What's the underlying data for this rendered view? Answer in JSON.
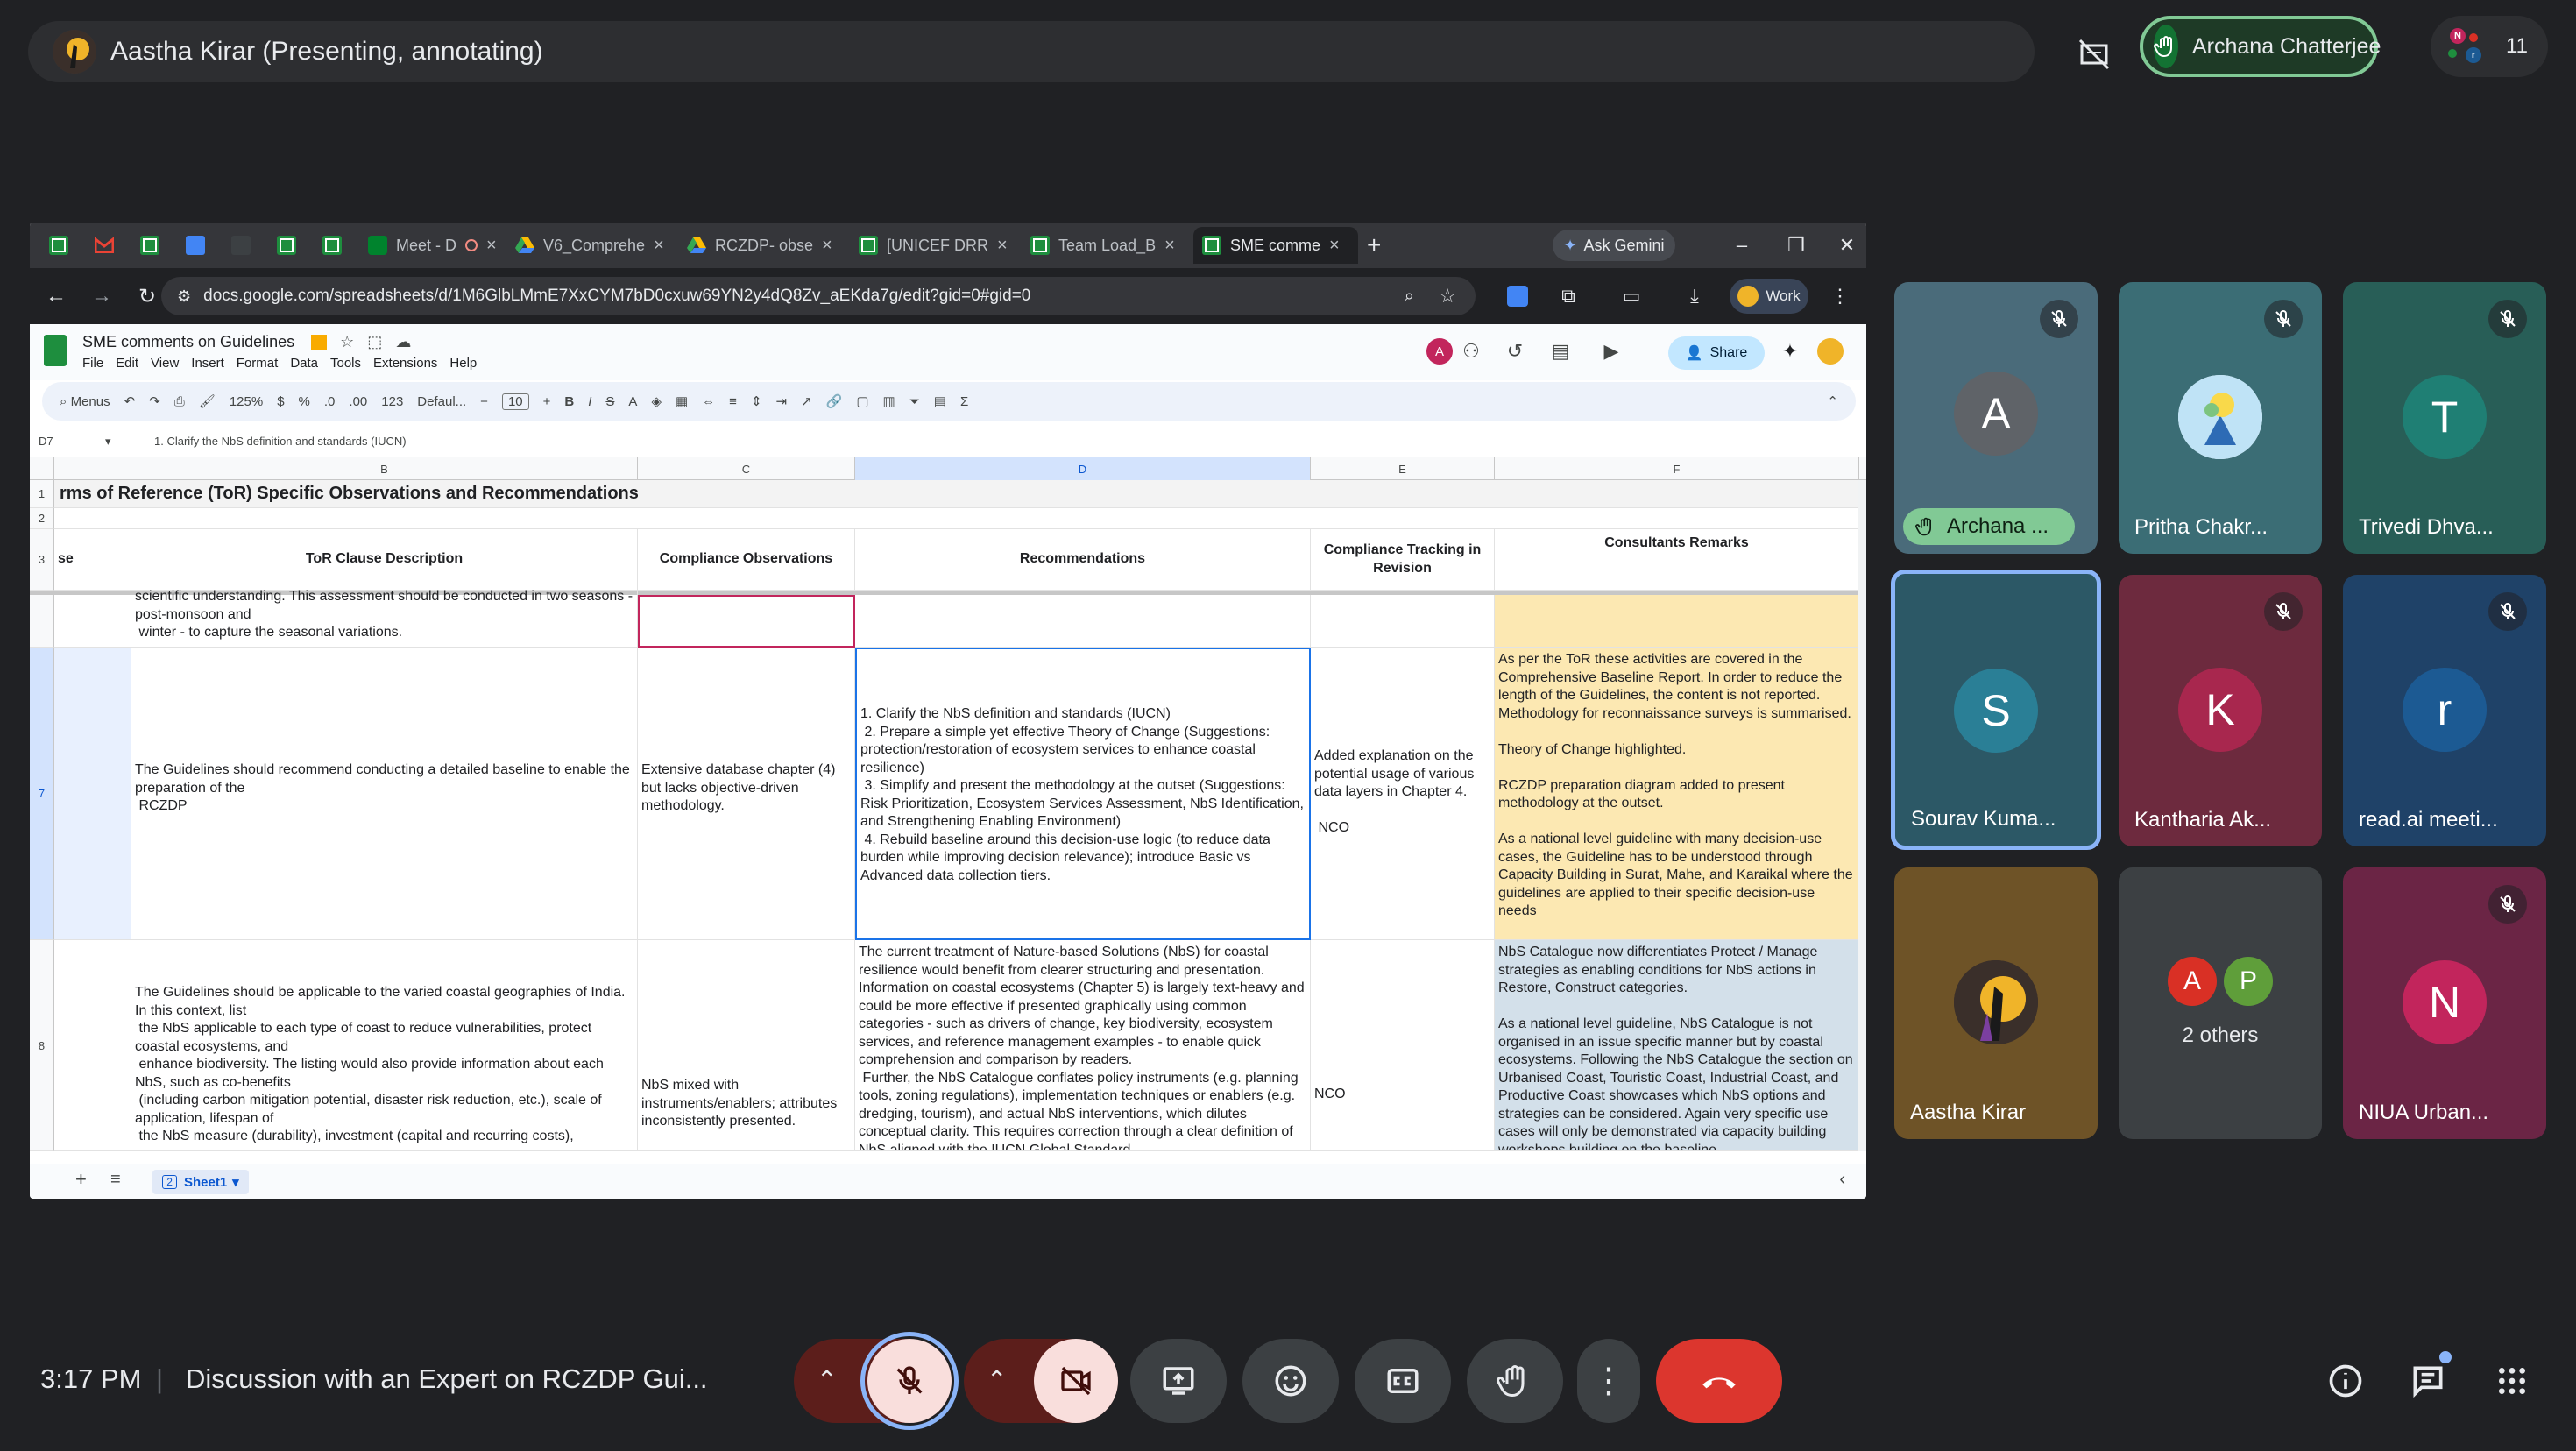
{
  "presenter": {
    "text": "Aastha Kirar (Presenting, annotating)"
  },
  "raised_hand": {
    "name": "Archana Chatterjee"
  },
  "people": {
    "count": "11",
    "mini_letters": [
      "N",
      "A",
      "P",
      "r"
    ]
  },
  "browser": {
    "tabs": [
      {
        "label": "",
        "icon": "sheets-icon"
      },
      {
        "label": "",
        "icon": "gmail-icon"
      },
      {
        "label": "",
        "icon": "sheets-icon"
      },
      {
        "label": "",
        "icon": "calendar-icon"
      },
      {
        "label": "",
        "icon": "apps-icon"
      },
      {
        "label": "",
        "icon": "sheets-icon"
      },
      {
        "label": "",
        "icon": "sheets-icon"
      },
      {
        "label": "Meet - D",
        "icon": "meet-icon"
      },
      {
        "label": "V6_Comprehe",
        "icon": "drive-icon"
      },
      {
        "label": "RCZDP- obse",
        "icon": "drive-icon"
      },
      {
        "label": "[UNICEF DRR",
        "icon": "sheets-icon"
      },
      {
        "label": "Team Load_B",
        "icon": "sheets-icon"
      },
      {
        "label": "SME comme",
        "icon": "sheets-icon"
      }
    ],
    "ask_gemini": "Ask Gemini",
    "url": "docs.google.com/spreadsheets/d/1M6GlbLMmE7XxCYM7bD0cxuw69YN2y4dQ8Zv_aEKda7g/edit?gid=0#gid=0",
    "profile": "Work"
  },
  "sheet": {
    "title": "SME comments on Guidelines",
    "menu": [
      "File",
      "Edit",
      "View",
      "Insert",
      "Format",
      "Data",
      "Tools",
      "Extensions",
      "Help"
    ],
    "share": "Share",
    "toolbar": {
      "menus": "Menus",
      "zoom": "125%",
      "currency": "$",
      "percent": "%",
      "dec1": ".0",
      "dec2": ".00",
      "numfmt": "123",
      "font": "Defaul...",
      "font_size": "10"
    },
    "cell_ref": "D7",
    "formula": "1. Clarify the NbS definition and standards (IUCN)",
    "columns": [
      "B",
      "C",
      "D",
      "E",
      "F"
    ],
    "row_numbers": [
      "1",
      "2",
      "3",
      "7",
      "8"
    ],
    "title_row": "rms of Reference (ToR) Specific Observations and Recommendations",
    "headers": {
      "a": "se",
      "b": "ToR Clause Description",
      "c": "Compliance Observations",
      "d": "Recommendations",
      "e": "Compliance Tracking in Revision",
      "f": "Consultants Remarks"
    },
    "partial_row": {
      "b": "scientific understanding. This assessment should be conducted in two seasons - post-monsoon and\n winter - to capture the seasonal variations."
    },
    "row7": {
      "b": "The Guidelines should recommend conducting a detailed baseline to enable the preparation of the\n RCZDP",
      "c": "Extensive database chapter (4) but lacks objective-driven methodology.",
      "d": "1. Clarify the NbS definition and standards (IUCN)\n 2. Prepare a simple yet effective Theory of Change (Suggestions: protection/restoration of ecosystem services to enhance coastal resilience)\n 3. Simplify and present the methodology at the outset (Suggestions: Risk Prioritization, Ecosystem Services Assessment, NbS Identification, and Strengthening Enabling Environment)\n 4. Rebuild baseline around this decision-use logic (to reduce data burden while improving decision relevance); introduce Basic vs Advanced data collection tiers.",
      "e": "Added explanation on the potential usage of various data layers in Chapter 4.\n\n NCO",
      "f": "As per the ToR these activities are covered in the Comprehensive Baseline Report. In order to reduce the length of the Guidelines, the content is not reported. Methodology for reconnaissance surveys is summarised.\n\nTheory of Change highlighted.\n\nRCZDP preparation diagram added to present methodology at the outset.\n\nAs a national level guideline with many decision-use cases, the Guideline has to be understood through Capacity Building in Surat, Mahe, and Karaikal where the guidelines are applied to their specific decision-use needs"
    },
    "row8": {
      "b": "The Guidelines should be applicable to the varied coastal geographies of India. In this context, list\n the NbS applicable to each type of coast to reduce vulnerabilities, protect coastal ecosystems, and\n enhance biodiversity. The listing would also provide information about each NbS, such as co-benefits\n (including carbon mitigation potential, disaster risk reduction, etc.), scale of application, lifespan of\n the NbS measure (durability), investment (capital and recurring costs),",
      "c": "NbS mixed with instruments/enablers; attributes inconsistently presented.",
      "d": "The current treatment of Nature-based Solutions (NbS) for coastal resilience would benefit from clearer structuring and presentation. Information on coastal ecosystems (Chapter 5) is largely text-heavy and could be more effective if presented graphically using common categories - such as drivers of change, key biodiversity, ecosystem services, and reference management examples - to enable quick comprehension and comparison by readers.\n Further, the NbS Catalogue conflates policy instruments (e.g. planning tools, zoning regulations), implementation techniques or enablers (e.g. dredging, tourism), and actual NbS interventions, which dilutes conceptual clarity. This requires correction through a clear definition of NbS aligned with the IUCN Global Standard.",
      "e": "NCO",
      "f": "NbS Catalogue now differentiates Protect / Manage strategies as enabling conditions for NbS actions in Restore, Construct categories.\n\nAs a national level guideline, NbS Catalogue is not organised in an issue specific manner but by coastal ecosystems. Following the NbS Catalogue the section on Urbanised Coast, Touristic Coast, Industrial Coast, and Productive Coast showcases which NbS options and strategies can be considered. Again very specific use cases will only be demonstrated via capacity building workshops building on the baseline"
    },
    "sheet_tab": {
      "num": "2",
      "name": "Sheet1"
    }
  },
  "participants": [
    {
      "name": "Archana ...",
      "initial": "A",
      "color": "#4a6b7a",
      "circle": "#5f6368",
      "muted": true,
      "hand": true
    },
    {
      "name": "Pritha Chakr...",
      "initial": "",
      "color": "#3b6d75",
      "circle": "#ffffff",
      "muted": true
    },
    {
      "name": "Trivedi Dhva...",
      "initial": "T",
      "color": "#285e57",
      "circle": "#1f7f74",
      "muted": true
    },
    {
      "name": "Sourav Kuma...",
      "initial": "S",
      "color": "#2c5866",
      "circle": "#2a7f96",
      "muted": false
    },
    {
      "name": "Kantharia Ak...",
      "initial": "K",
      "color": "#6d2a3e",
      "circle": "#a8274e",
      "muted": true
    },
    {
      "name": "read.ai meeti...",
      "initial": "r",
      "color": "#1f4268",
      "circle": "#1c5a93",
      "muted": true
    },
    {
      "name": "Aastha Kirar",
      "initial": "",
      "color": "#6e5327",
      "circle": "#3a2f2a",
      "muted": false
    },
    {
      "name": "2 others",
      "initial": "",
      "color": "#3c4043",
      "circle": "",
      "muted": false,
      "others": [
        "A",
        "P"
      ]
    },
    {
      "name": "NIUA Urban...",
      "initial": "N",
      "color": "#6b2545",
      "circle": "#c2255c",
      "muted": true
    }
  ],
  "bottom": {
    "time": "3:17 PM",
    "separator": "|",
    "meeting_title": "Discussion with an Expert on RCZDP Gui..."
  },
  "colors": {
    "end_call": "#dc362e",
    "muted_red": "#5c1e1b",
    "accent_blue": "#8ab4f8"
  }
}
